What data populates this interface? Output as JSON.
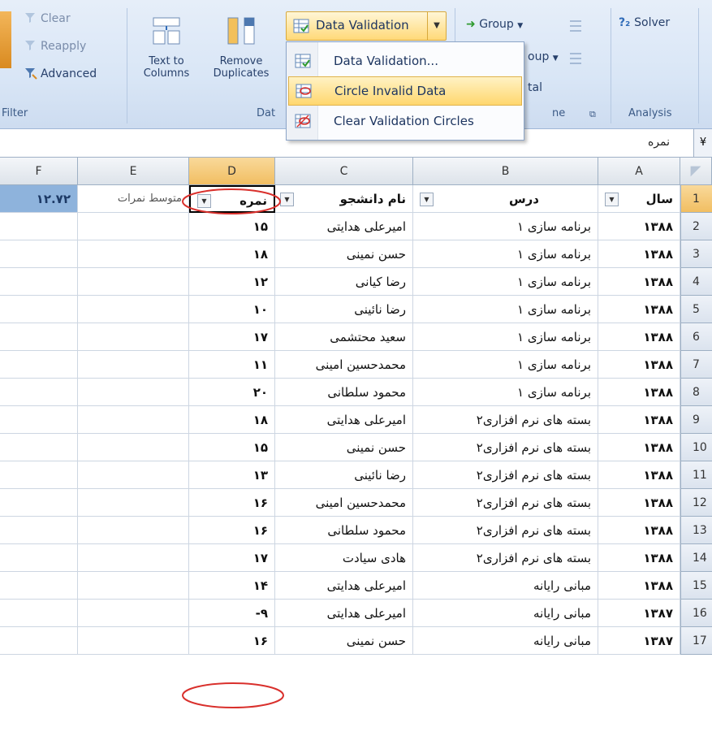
{
  "ribbon": {
    "sort_filter": {
      "clear": "Clear",
      "reapply": "Reapply",
      "advanced": "Advanced",
      "label": "Filter"
    },
    "data_tools": {
      "text_to_columns_l1": "Text to",
      "text_to_columns_l2": "Columns",
      "remove_duplicates_l1": "Remove",
      "remove_duplicates_l2": "Duplicates",
      "label_visible": "Dat",
      "data_validation": "Data Validation"
    },
    "outline": {
      "group": "Group",
      "ungroup_visible": "oup",
      "subtotal_visible": "tal",
      "label_visible": "ne"
    },
    "analysis": {
      "solver": "Solver",
      "label": "Analysis"
    }
  },
  "menu": {
    "items": [
      {
        "label": "Data Validation..."
      },
      {
        "label": "Circle Invalid Data"
      },
      {
        "label": "Clear Validation Circles"
      }
    ]
  },
  "formula_bar": {
    "value": "نمره",
    "expand": "¥"
  },
  "columns": [
    "F",
    "E",
    "D",
    "C",
    "B",
    "A"
  ],
  "header_row": {
    "num": "1",
    "F": "۱۲.۷۲",
    "E": "متوسط نمرات",
    "D": "نمره",
    "C": "نام دانشجو",
    "B": "درس",
    "A": "سال"
  },
  "rows": [
    {
      "num": "2",
      "A": "۱۳۸۸",
      "B": "برنامه سازی ۱",
      "C": "امیرعلی هدایتی",
      "D": "۱۵"
    },
    {
      "num": "3",
      "A": "۱۳۸۸",
      "B": "برنامه سازی ۱",
      "C": "حسن نمینی",
      "D": "۱۸"
    },
    {
      "num": "4",
      "A": "۱۳۸۸",
      "B": "برنامه سازی ۱",
      "C": "رضا کیانی",
      "D": "۱۲"
    },
    {
      "num": "5",
      "A": "۱۳۸۸",
      "B": "برنامه سازی ۱",
      "C": "رضا نائینی",
      "D": "۱۰"
    },
    {
      "num": "6",
      "A": "۱۳۸۸",
      "B": "برنامه سازی ۱",
      "C": "سعید محتشمی",
      "D": "۱۷"
    },
    {
      "num": "7",
      "A": "۱۳۸۸",
      "B": "برنامه سازی ۱",
      "C": "محمدحسین امینی",
      "D": "۱۱"
    },
    {
      "num": "8",
      "A": "۱۳۸۸",
      "B": "برنامه سازی ۱",
      "C": "محمود سلطانی",
      "D": "۲۰"
    },
    {
      "num": "9",
      "A": "۱۳۸۸",
      "B": "بسته های نرم افزاری۲",
      "C": "امیرعلی هدایتی",
      "D": "۱۸"
    },
    {
      "num": "10",
      "A": "۱۳۸۸",
      "B": "بسته های نرم افزاری۲",
      "C": "حسن نمینی",
      "D": "۱۵"
    },
    {
      "num": "11",
      "A": "۱۳۸۸",
      "B": "بسته های نرم افزاری۲",
      "C": "رضا نائینی",
      "D": "۱۳"
    },
    {
      "num": "12",
      "A": "۱۳۸۸",
      "B": "بسته های نرم افزاری۲",
      "C": "محمدحسین امینی",
      "D": "۱۶"
    },
    {
      "num": "13",
      "A": "۱۳۸۸",
      "B": "بسته های نرم افزاری۲",
      "C": "محمود سلطانی",
      "D": "۱۶"
    },
    {
      "num": "14",
      "A": "۱۳۸۸",
      "B": "بسته های نرم افزاری۲",
      "C": "هادی سیادت",
      "D": "۱۷"
    },
    {
      "num": "15",
      "A": "۱۳۸۸",
      "B": "مبانی رایانه",
      "C": "امیرعلی هدایتی",
      "D": "۱۴"
    },
    {
      "num": "16",
      "A": "۱۳۸۷",
      "B": "مبانی رایانه",
      "C": "امیرعلی هدایتی",
      "D": "-۹"
    },
    {
      "num": "17",
      "A": "۱۳۸۷",
      "B": "مبانی رایانه",
      "C": "حسن نمینی",
      "D": "۱۶"
    }
  ],
  "colors": {
    "accent": "#f1be62",
    "circle": "#d9302c",
    "total_cell": "#8eb3dc"
  }
}
